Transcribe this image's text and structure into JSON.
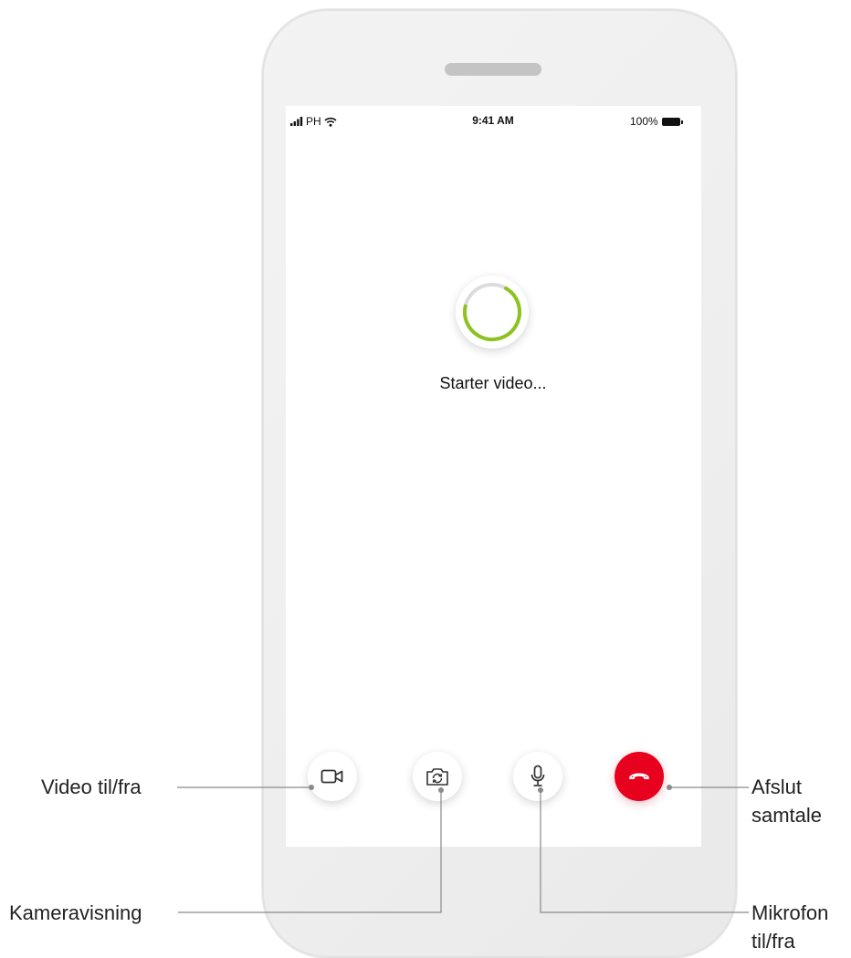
{
  "status_bar": {
    "carrier": "PH",
    "time": "9:41 AM",
    "battery": "100%"
  },
  "loading": {
    "text": "Starter video...",
    "spinner_color": "#8cc31e",
    "progress": 0.7
  },
  "controls": [
    {
      "icon": "video-camera-icon",
      "label": "Video til/fra"
    },
    {
      "icon": "camera-switch-icon",
      "label": "Kameravisning"
    },
    {
      "icon": "microphone-icon",
      "label": "Mikrofon til/fra"
    },
    {
      "icon": "end-call-icon",
      "label": "Afslut samtale",
      "color": "#e8001f"
    }
  ],
  "callouts": {
    "video": "Video til/fra",
    "camera": "Kameravisning",
    "mic_line1": "Mikrofon",
    "mic_line2": "til/fra",
    "end_line1": "Afslut",
    "end_line2": "samtale"
  }
}
